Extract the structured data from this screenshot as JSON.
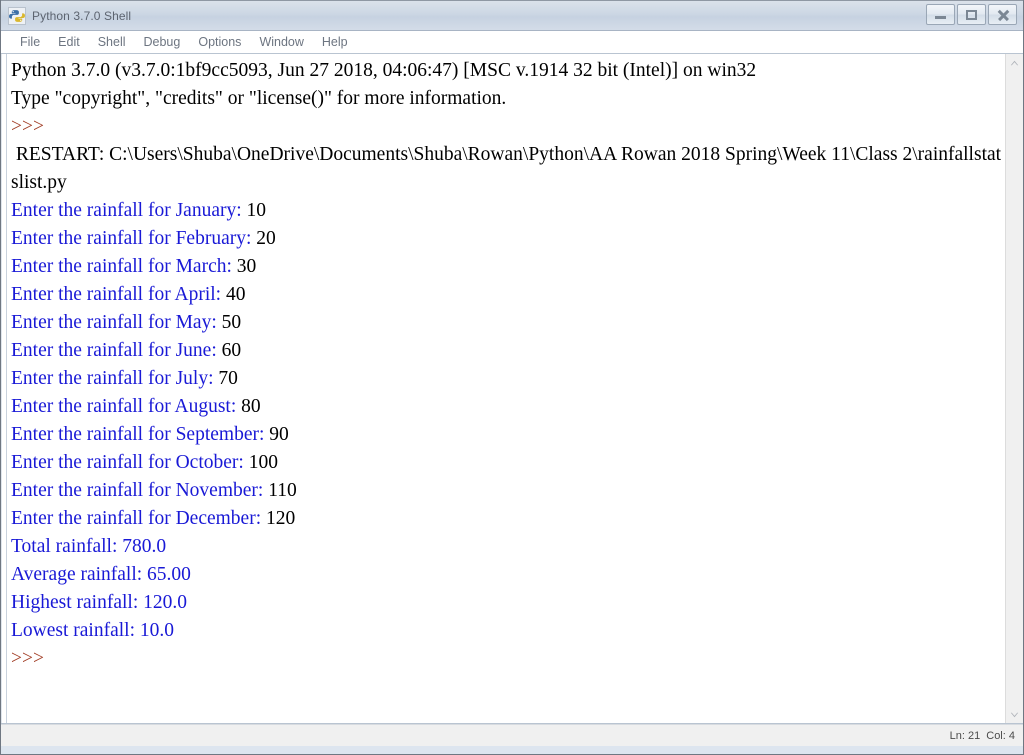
{
  "window": {
    "title": "Python 3.7.0 Shell",
    "icon": "python-logo-icon",
    "buttons": {
      "minimize": "Minimize",
      "maximize": "Maximize",
      "close": "Close"
    }
  },
  "menubar": {
    "items": [
      {
        "label": "File"
      },
      {
        "label": "Edit"
      },
      {
        "label": "Shell"
      },
      {
        "label": "Debug"
      },
      {
        "label": "Options"
      },
      {
        "label": "Window"
      },
      {
        "label": "Help"
      }
    ]
  },
  "console": {
    "lines": [
      {
        "id": "banner-version",
        "segments": [
          {
            "text": "Python 3.7.0 (v3.7.0:1bf9cc5093, Jun 27 2018, 04:06:47) [MSC v.1914 32 bit (Intel)] on win32",
            "color": "black"
          }
        ]
      },
      {
        "id": "banner-help",
        "segments": [
          {
            "text": "Type \"copyright\", \"credits\" or \"license()\" for more information.",
            "color": "black"
          }
        ]
      },
      {
        "id": "prompt-1",
        "segments": [
          {
            "text": ">>> ",
            "color": "prompt"
          }
        ]
      },
      {
        "id": "restart-line",
        "segments": [
          {
            "text": " RESTART: C:\\Users\\Shuba\\OneDrive\\Documents\\Shuba\\Rowan\\Python\\AA Rowan 2018 Spring\\Week 11\\Class 2\\rainfallstatslist.py",
            "color": "black"
          }
        ]
      },
      {
        "id": "input-january",
        "segments": [
          {
            "text": "Enter the rainfall for January: ",
            "color": "blue"
          },
          {
            "text": "10",
            "color": "black"
          }
        ]
      },
      {
        "id": "input-february",
        "segments": [
          {
            "text": "Enter the rainfall for February: ",
            "color": "blue"
          },
          {
            "text": "20",
            "color": "black"
          }
        ]
      },
      {
        "id": "input-march",
        "segments": [
          {
            "text": "Enter the rainfall for March: ",
            "color": "blue"
          },
          {
            "text": "30",
            "color": "black"
          }
        ]
      },
      {
        "id": "input-april",
        "segments": [
          {
            "text": "Enter the rainfall for April: ",
            "color": "blue"
          },
          {
            "text": "40",
            "color": "black"
          }
        ]
      },
      {
        "id": "input-may",
        "segments": [
          {
            "text": "Enter the rainfall for May: ",
            "color": "blue"
          },
          {
            "text": "50",
            "color": "black"
          }
        ]
      },
      {
        "id": "input-june",
        "segments": [
          {
            "text": "Enter the rainfall for June: ",
            "color": "blue"
          },
          {
            "text": "60",
            "color": "black"
          }
        ]
      },
      {
        "id": "input-july",
        "segments": [
          {
            "text": "Enter the rainfall for July: ",
            "color": "blue"
          },
          {
            "text": "70",
            "color": "black"
          }
        ]
      },
      {
        "id": "input-august",
        "segments": [
          {
            "text": "Enter the rainfall for August: ",
            "color": "blue"
          },
          {
            "text": "80",
            "color": "black"
          }
        ]
      },
      {
        "id": "input-september",
        "segments": [
          {
            "text": "Enter the rainfall for September: ",
            "color": "blue"
          },
          {
            "text": "90",
            "color": "black"
          }
        ]
      },
      {
        "id": "input-october",
        "segments": [
          {
            "text": "Enter the rainfall for October: ",
            "color": "blue"
          },
          {
            "text": "100",
            "color": "black"
          }
        ]
      },
      {
        "id": "input-november",
        "segments": [
          {
            "text": "Enter the rainfall for November: ",
            "color": "blue"
          },
          {
            "text": "110",
            "color": "black"
          }
        ]
      },
      {
        "id": "input-december",
        "segments": [
          {
            "text": "Enter the rainfall for December: ",
            "color": "blue"
          },
          {
            "text": "120",
            "color": "black"
          }
        ]
      },
      {
        "id": "result-total",
        "segments": [
          {
            "text": "Total rainfall: 780.0",
            "color": "blue"
          }
        ]
      },
      {
        "id": "result-average",
        "segments": [
          {
            "text": "Average rainfall: 65.00",
            "color": "blue"
          }
        ]
      },
      {
        "id": "result-highest",
        "segments": [
          {
            "text": "Highest rainfall: 120.0",
            "color": "blue"
          }
        ]
      },
      {
        "id": "result-lowest",
        "segments": [
          {
            "text": "Lowest rainfall: 10.0",
            "color": "blue"
          }
        ]
      },
      {
        "id": "prompt-2",
        "segments": [
          {
            "text": ">>> ",
            "color": "prompt"
          }
        ]
      }
    ]
  },
  "scrollbar": {
    "up_arrow": "chevron-up-icon",
    "down_arrow": "chevron-down-icon"
  },
  "statusbar": {
    "line_label": "Ln: 21",
    "col_label": "Col: 4"
  },
  "colors": {
    "prompt_red": "#a03a22",
    "output_blue": "#1919d6",
    "text_black": "#000000",
    "titlebar_text": "#5d6470",
    "menu_text": "#6d7581"
  }
}
